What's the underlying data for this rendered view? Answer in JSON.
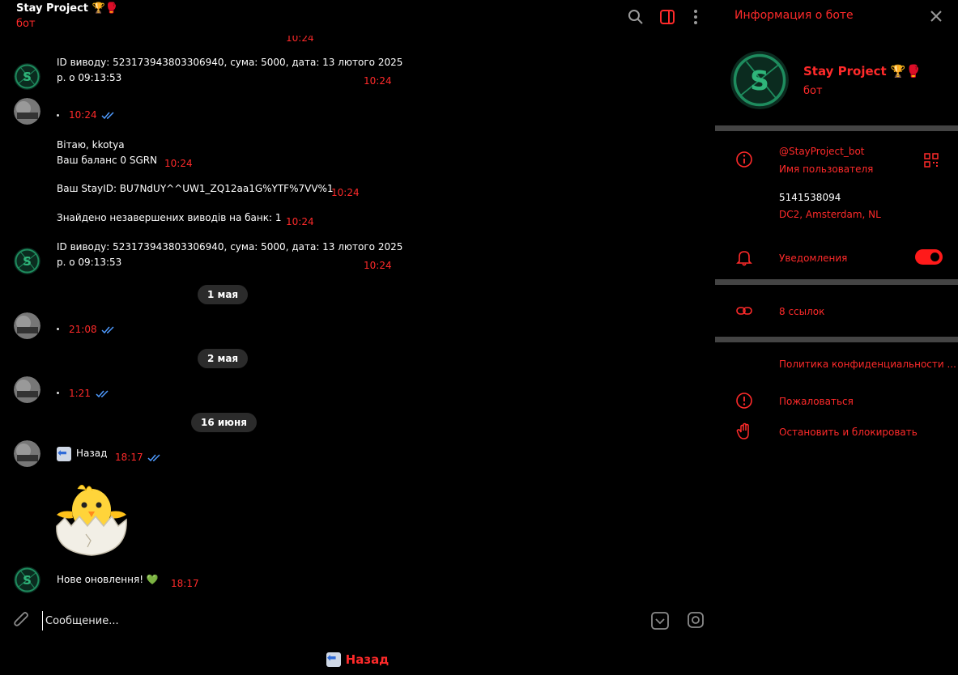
{
  "chat_header": {
    "title": "Stay Project 🏆🥊",
    "subtitle": "бот"
  },
  "messages": {
    "partial_time_top": "10:24",
    "withdrawal_1": {
      "line1": "ID виводу: 523173943803306940, сума: 5000, дата: 13 лютого 2025",
      "line2": "р. о 09:13:53",
      "time": "10:24"
    },
    "user_dot_1": {
      "time": "10:24"
    },
    "welcome": {
      "line1": "Вітаю, kkotya",
      "line2": "Ваш баланс 0 SGRN",
      "time": "10:24"
    },
    "stayid": {
      "text": "Ваш StayID: BU7NdUY^^UW1_ZQ12aa1G%YTF%7VV%1",
      "time": "10:24"
    },
    "pending": {
      "text": "Знайдено незавершених виводів на банк: 1",
      "time": "10:24"
    },
    "withdrawal_2": {
      "line1": "ID виводу: 523173943803306940, сума: 5000, дата: 13 лютого 2025",
      "line2": "р. о 09:13:53",
      "time": "10:24"
    },
    "date_1": "1 мая",
    "user_dot_2": {
      "time": "21:08"
    },
    "date_2": "2 мая",
    "user_dot_3": {
      "time": "1:21"
    },
    "date_3": "16 июня",
    "back_msg": {
      "text": "Назад",
      "time": "18:17"
    },
    "update": {
      "text": "Нове оновлення! 💚",
      "time": "18:17"
    }
  },
  "composer": {
    "placeholder": "Сообщение..."
  },
  "reply_keyboard": {
    "back_label": "Назад"
  },
  "info_panel": {
    "title": "Информация о боте",
    "name": "Stay Project 🏆🥊",
    "role": "бот",
    "username": "@StayProject_bot",
    "username_caption": "Имя пользователя",
    "user_id": "5141538094",
    "dc": "DC2, Amsterdam, NL",
    "notifications_label": "Уведомления",
    "notifications_on": true,
    "links_label": "8 ссылок",
    "privacy_label": "Политика конфиденциальности ...",
    "report_label": "Пожаловаться",
    "block_label": "Остановить и блокировать"
  },
  "colors": {
    "accent": "#ff2a2a",
    "bot_avatar": "#1e6b4a",
    "tick": "#4f9bff",
    "pill": "#2b2b2b",
    "divider": "#444444"
  },
  "icons": {
    "header": [
      "search-icon",
      "side-panel-icon",
      "kebab-menu-icon"
    ],
    "composer": [
      "paperclip-icon",
      "keyboard-icon",
      "sticker-icon"
    ],
    "info": [
      "info-icon",
      "qr-code-icon",
      "bell-icon",
      "link-icon",
      "alert-icon",
      "hand-icon",
      "close-icon"
    ]
  }
}
